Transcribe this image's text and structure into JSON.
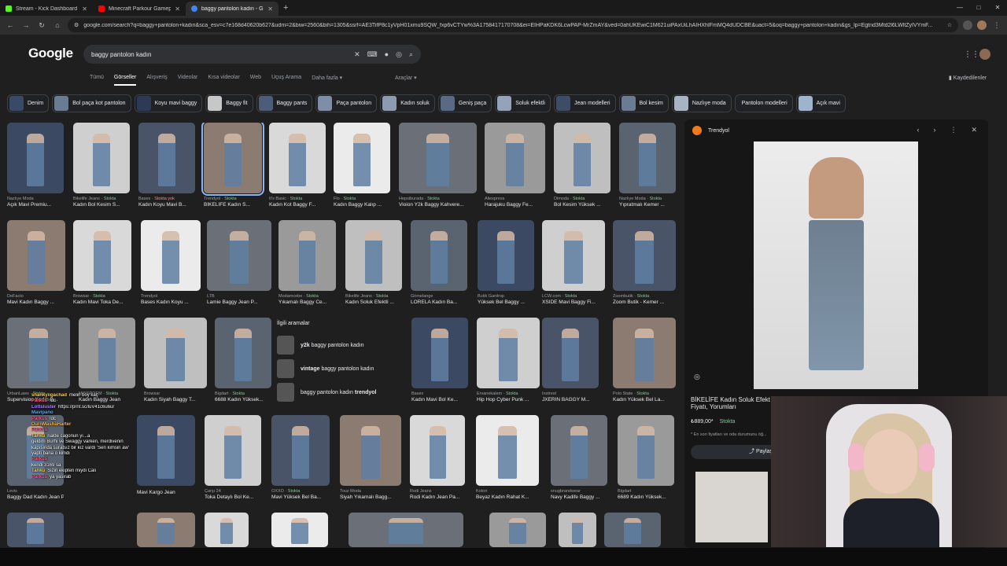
{
  "browser": {
    "tabs": [
      {
        "title": "Stream - Kick Dashboard",
        "color": "#53fc18"
      },
      {
        "title": "Minecraft Parkour Gameplay",
        "color": "#ff0000"
      },
      {
        "title": "baggy pantolon kadın - Google",
        "color": "#4285f4",
        "active": true
      }
    ],
    "url": "google.com/search?q=baggy+pantolon+kadın&sca_esv=c7e168d40620b627&udm=2&biw=2560&bih=1305&ssrf=AE3TifP8c1yVpH01xmu9SQW_fxp6vCTYw%3A1758417170708&ei=EIHPaKDK6LcwPAP-MrZmAY&ved=0ahUKEwiC1M621uiPAxUiLhAIHXhIFmMQ4dUDCBE&uact=5&oq=baggy+pantolon+kadın&gs_lp=Egtnd3Mtd2l6LWltZyIVYmF..."
  },
  "google": {
    "logo": "Google",
    "query": "baggy pantolon kadın",
    "tabs": [
      "Tümü",
      "Görseller",
      "Alışveriş",
      "Videolar",
      "Kısa videolar",
      "Web",
      "Uçuş Arama",
      "Daha fazla ▾"
    ],
    "active_tab": "Görseller",
    "tools": "Araçlar ▾",
    "saved": "Kaydedilenler"
  },
  "chips": [
    "Denim",
    "Bol paça kot pantolon",
    "Koyu mavi baggy",
    "Baggy fit",
    "Baggy pants",
    "Paça pantolon",
    "Kadın soluk",
    "Geniş paça",
    "Soluk efektli",
    "Jean modelleri",
    "Bol kesim",
    "Nazlıye moda",
    "Pantolon modelleri",
    "Açık mavi"
  ],
  "results": [
    {
      "src": "Nazlıye Moda",
      "title": "Açık Mavi Premiu..."
    },
    {
      "src": "Bikelife Jeans · ",
      "stock": "Stokta",
      "title": "Kadın Bol Kesim S..."
    },
    {
      "src": "Bases · ",
      "nostock": "Stokta yok",
      "title": "Kadın Koyu Mavi B..."
    },
    {
      "src": "Trendyol · ",
      "stock": "Stokta",
      "title": "BİKELİFE Kadın S...",
      "selected": true
    },
    {
      "src": "It's Basic · ",
      "stock": "Stokta",
      "title": "Kadın Kot Baggy F..."
    },
    {
      "src": "Flo · ",
      "stock": "Stokta",
      "title": "Kadın Baggy Kalıp ..."
    },
    {
      "src": "Hepsiburada · ",
      "stock": "Stokta",
      "title": "Vioion Y2k Baggy Kahvere..."
    },
    {
      "src": "Aliexpress",
      "title": "Harajuku Baggy Fe..."
    },
    {
      "src": "Dimoda · ",
      "stock": "Stokta",
      "title": "Bol Kesim Yüksek ..."
    },
    {
      "src": "Nazlıye Moda · ",
      "stock": "Stokta",
      "title": "Yıpratmalı Kemer ..."
    },
    {
      "src": "DeFacto",
      "title": "Mavi Kadın Baggy ..."
    },
    {
      "src": "Browsar · ",
      "stock": "Stokta",
      "title": "Kadın Mavi Toka De..."
    },
    {
      "src": "Trendyol",
      "title": "Bases Kadın Koyu ..."
    },
    {
      "src": "LTB",
      "title": "Lamie Baggy Jean P..."
    },
    {
      "src": "Modamcebe · ",
      "stock": "Stokta",
      "title": "Yıkamalı Baggy Ce..."
    },
    {
      "src": "Bikelife Jeans · ",
      "stock": "Stokta",
      "title": "Kadın Soluk Efektli ..."
    },
    {
      "src": "Grimelange",
      "title": "LORELA Kadın Ba..."
    },
    {
      "src": "Butik Gardrop",
      "title": "Yüksek Bel Baggy ..."
    },
    {
      "src": "LCW.com · ",
      "stock": "Stokta",
      "title": "XSIDE Mavi Baggy Fi..."
    },
    {
      "src": "Zoombutik · ",
      "stock": "Stokta",
      "title": "Zoom Butik - Kemer ..."
    },
    {
      "src": "UrbanLaws · ",
      "stock": "Stokta",
      "title": "Supervision Kadın B..."
    },
    {
      "src": "MISSPOEM · ",
      "stock": "Stokta",
      "title": "Kadın Baggy Jean"
    },
    {
      "src": "Browsar",
      "title": "Kadın Siyah Baggy T..."
    },
    {
      "src": "Bigdart · ",
      "stock": "Stokta",
      "title": "6688 Kadın Yüksek..."
    },
    {
      "src": "Bases",
      "title": "Kadın Mavi Bol Ke..."
    },
    {
      "src": "Ervanekalem · ",
      "stock": "Stokta",
      "title": "Hip Hop Cyber Punk ..."
    },
    {
      "src": "Instrest",
      "title": "JXERIN BAGGY M..."
    },
    {
      "src": "Polo State · ",
      "stock": "Stokta",
      "title": "Kadın Yüksek Bel La..."
    },
    {
      "src": "Levis",
      "title": "Baggy Dad Kadın Jean Pantolon"
    },
    {
      "src": "",
      "title": "Mavi Kargo Jean"
    },
    {
      "src": "Çarşı 24",
      "title": "Toka Detaylı Bol Ke..."
    },
    {
      "src": "OXXO · ",
      "stock": "Stokta",
      "title": "Mavi Yüksek Bel Ba..."
    },
    {
      "src": "Touz Moda",
      "title": "Siyah Yıkamalı Bagg..."
    },
    {
      "src": "Rodi Jeans",
      "title": "Rodi Kadın Jean Pa..."
    },
    {
      "src": "Koton",
      "title": "Beyaz Kadın Rahat K..."
    },
    {
      "src": "snugbrandwear",
      "title": "Navy Kadife Baggy ..."
    },
    {
      "src": "Bigdart",
      "title": "6689 Kadın Yüksek..."
    }
  ],
  "related": {
    "heading": "İlgili aramalar",
    "items": [
      {
        "pre": "y2k",
        "rest": " baggy pantolon kadın"
      },
      {
        "pre": "vintage",
        "rest": " baggy pantolon kadın"
      },
      {
        "pre": "baggy pantolon kadın ",
        "rest": "trendyol"
      }
    ]
  },
  "preview": {
    "source": "Trendyol",
    "title": "BİKELİFE Kadın Soluk Efekt Fiyatı, Yorumları",
    "price": "₺889,00*",
    "stock": "Stokta",
    "note": "* En son fiyatları ve oda durumunu öğ...",
    "share": "Paylaş"
  },
  "chat": [
    {
      "name": "shankyiigachad",
      "color": "#ffd54a",
      "msg": "melin boy kaç"
    },
    {
      "name": "Parkus",
      "color": "#ff5c8a",
      "msg": "!dc"
    },
    {
      "name": "Lottsluster",
      "color": "#b084ff",
      "msg": "https://prnt.sc/luV41c6u6ur"
    },
    {
      "name": "Mavipano",
      "color": "#5aa9ff",
      "msg": ""
    },
    {
      "name": "Parkus",
      "color": "#ff5c8a",
      "msg": "!dc"
    },
    {
      "name": "DurnMashaHarter",
      "color": "#ffb74d",
      "msg": ""
    },
    {
      "name": "Parkus",
      "color": "#ff5c8a",
      "msg": ""
    },
    {
      "name": "Tanku",
      "color": "#ffd54a",
      "msg": "nalde cagonun yı...a"
    },
    {
      "name": "",
      "color": "#ffffff",
      "msg": "geldim Burhi ve Swaggy varken, merdivenin"
    },
    {
      "name": "",
      "color": "#ffffff",
      "msg": "kapısında suratsız bir kız vardı 'Sen kimsin aw'"
    },
    {
      "name": "",
      "color": "#ffffff",
      "msg": "yaptı bana o kimdi"
    },
    {
      "name": "Parkus",
      "color": "#ff5c8a",
      "msg": ""
    },
    {
      "name": "",
      "color": "#ffffff",
      "msg": "kendi 3169 sa"
    },
    {
      "name": "Tanku",
      "color": "#ffd54a",
      "msg": "Sizin ekipten miydi Calı"
    },
    {
      "name": "Parkus",
      "color": "#ff5c8a",
      "msg": "ya yasirab"
    }
  ]
}
